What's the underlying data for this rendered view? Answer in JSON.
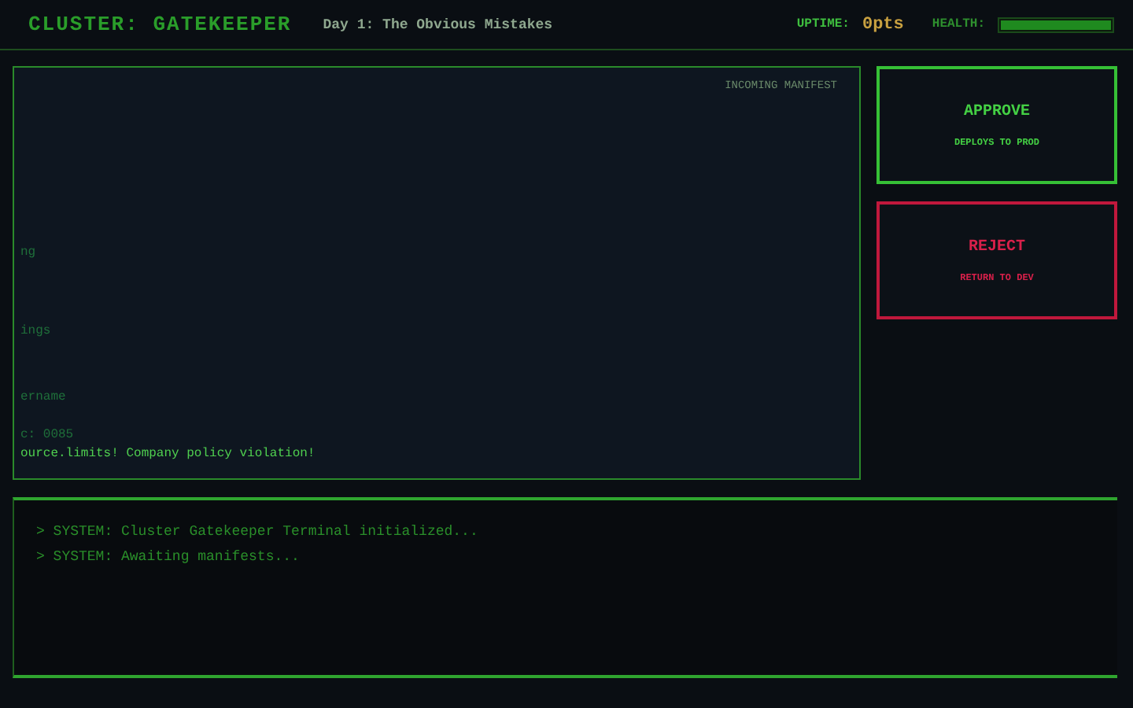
{
  "header": {
    "title": "CLUSTER: GATEKEEPER",
    "subtitle": "Day 1: The Obvious Mistakes",
    "uptime_label": "UPTIME:",
    "uptime_value": "0pts",
    "health_label": "HEALTH:",
    "health": {
      "level": 1
    }
  },
  "manifest": {
    "label": "INCOMING MANIFEST",
    "lines": [
      {
        "text": "ng",
        "kind": "dim"
      },
      {
        "text": "ings",
        "kind": "dim"
      },
      {
        "text": "ername",
        "kind": "dim"
      },
      {
        "text": "c: 0085",
        "kind": "dim"
      },
      {
        "text": "ource.limits! Company policy violation!",
        "kind": "warn"
      }
    ]
  },
  "actions": [
    {
      "kind": "approve",
      "label": "APPROVE",
      "hint": "DEPLOYS TO PROD"
    },
    {
      "kind": "reject",
      "label": "REJECT",
      "hint": "RETURN TO DEV"
    }
  ],
  "log": [
    "> SYSTEM: Cluster Gatekeeper Terminal initialized...",
    "> SYSTEM: Awaiting manifests..."
  ]
}
